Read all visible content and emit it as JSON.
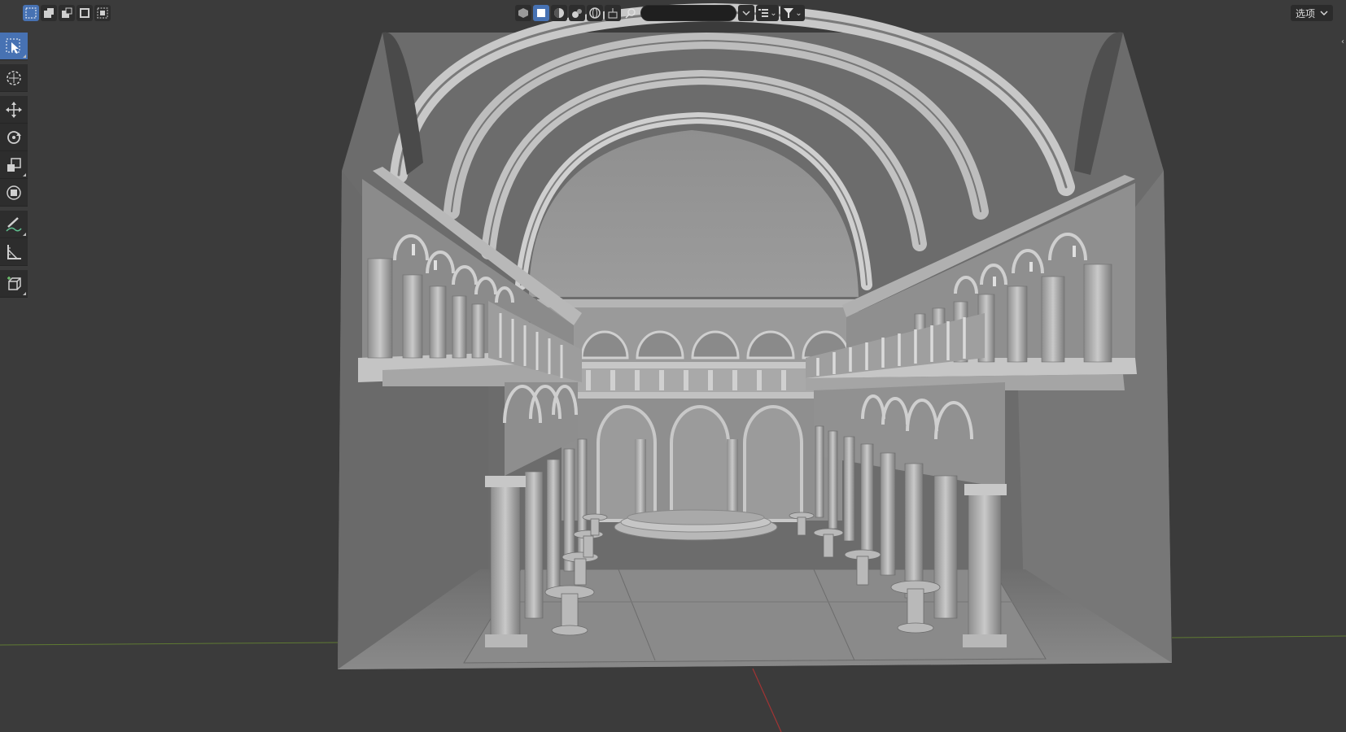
{
  "header": {
    "options_label": "选项",
    "search_value": ""
  },
  "toolbar": {
    "tools": [
      {
        "name": "select-box-tool",
        "icon": "select-cursor-icon",
        "active": true
      },
      {
        "name": "cursor-tool",
        "icon": "crosshair-icon",
        "active": false
      },
      {
        "name": "move-tool",
        "icon": "move-arrows-icon",
        "active": false
      },
      {
        "name": "rotate-tool",
        "icon": "rotate-icon",
        "active": false
      },
      {
        "name": "scale-tool",
        "icon": "scale-icon",
        "active": false
      },
      {
        "name": "transform-tool",
        "icon": "transform-icon",
        "active": false
      },
      {
        "name": "annotate-tool",
        "icon": "pencil-icon",
        "active": false
      },
      {
        "name": "measure-tool",
        "icon": "ruler-icon",
        "active": false
      },
      {
        "name": "add-cube-tool",
        "icon": "cube-icon",
        "active": false
      }
    ]
  },
  "colors": {
    "accent": "#4772b3",
    "viewport_bg": "#3b3b3b",
    "x_axis": "#b33a3a",
    "y_axis": "#6a8f2f"
  }
}
